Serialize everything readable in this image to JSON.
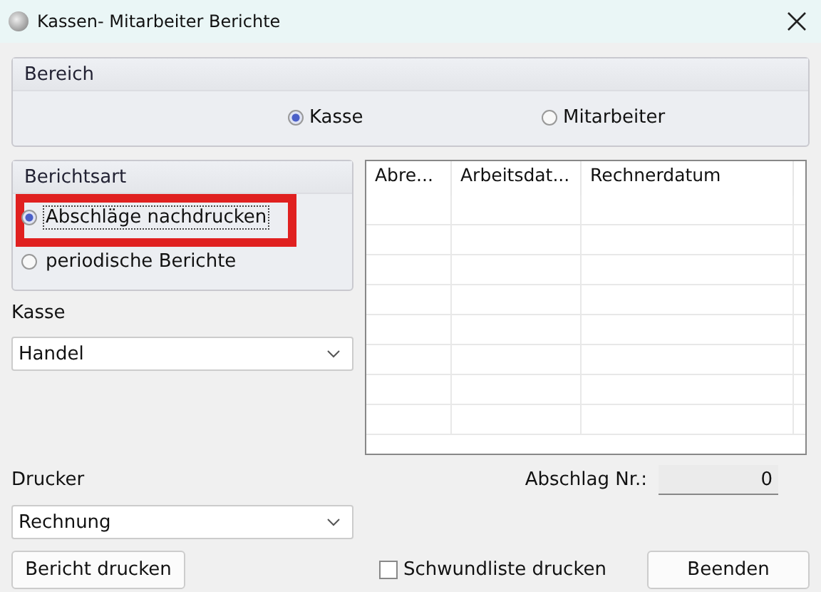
{
  "window": {
    "title": "Kassen- Mitarbeiter Berichte"
  },
  "bereich": {
    "title": "Bereich",
    "options": [
      {
        "label": "Kasse",
        "selected": true
      },
      {
        "label": "Mitarbeiter",
        "selected": false
      }
    ]
  },
  "berichtsart": {
    "title": "Berichtsart",
    "options": [
      {
        "label": "Abschläge nachdrucken",
        "selected": true,
        "focused": true
      },
      {
        "label": "periodische Berichte",
        "selected": false,
        "focused": false
      }
    ]
  },
  "annotation": {
    "kind": "rectangle"
  },
  "kasse": {
    "label": "Kasse",
    "value": "Handel"
  },
  "table": {
    "columns": [
      "Abre...",
      "Arbeitsdat...",
      "Rechnerdatum"
    ]
  },
  "drucker": {
    "label": "Drucker",
    "value": "Rechnung"
  },
  "abschlag": {
    "label": "Abschlag Nr.:",
    "value": "0"
  },
  "schwundliste": {
    "label": "Schwundliste drucken",
    "checked": false
  },
  "buttons": [
    "Bericht drucken",
    "Beenden"
  ]
}
